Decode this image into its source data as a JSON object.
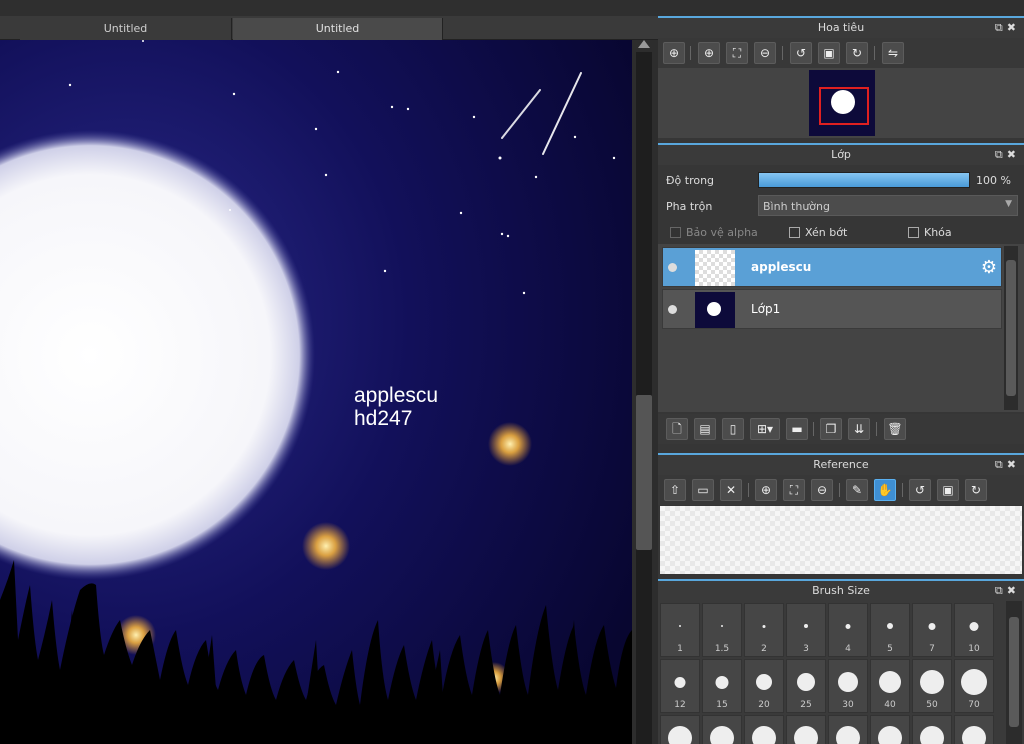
{
  "tabs": [
    "Untitled",
    "Untitled"
  ],
  "canvas": {
    "text_line1": "applescu",
    "text_line2": "hd247"
  },
  "navigator": {
    "title": "Hoa tiêu",
    "tools": [
      "zoom-fit-icon",
      "zoom-in-icon",
      "fit-screen-icon",
      "zoom-out-icon",
      "rotate-left-icon",
      "actual-size-icon",
      "rotate-right-icon",
      "flip-icon"
    ]
  },
  "layers": {
    "title": "Lớp",
    "opacity_label": "Độ trong",
    "opacity_value": "100 %",
    "opacity_fraction": 1.0,
    "blend_label": "Pha trộn",
    "blend_value": "Bình thường",
    "protect_alpha": "Bảo vệ alpha",
    "clipping": "Xén bớt",
    "lock": "Khóa",
    "items": [
      {
        "name": "applescu",
        "selected": true
      },
      {
        "name": "Lớp1",
        "selected": false
      }
    ]
  },
  "reference": {
    "title": "Reference"
  },
  "brush_size": {
    "title": "Brush Size",
    "sizes": [
      "1",
      "1.5",
      "2",
      "3",
      "4",
      "5",
      "7",
      "10",
      "12",
      "15",
      "20",
      "25",
      "30",
      "40",
      "50",
      "70",
      "",
      "",
      "",
      "",
      "",
      "",
      "",
      ""
    ]
  },
  "colors": {
    "accent": "#5aa0d6",
    "sky_dark": "#0d0a3a"
  }
}
